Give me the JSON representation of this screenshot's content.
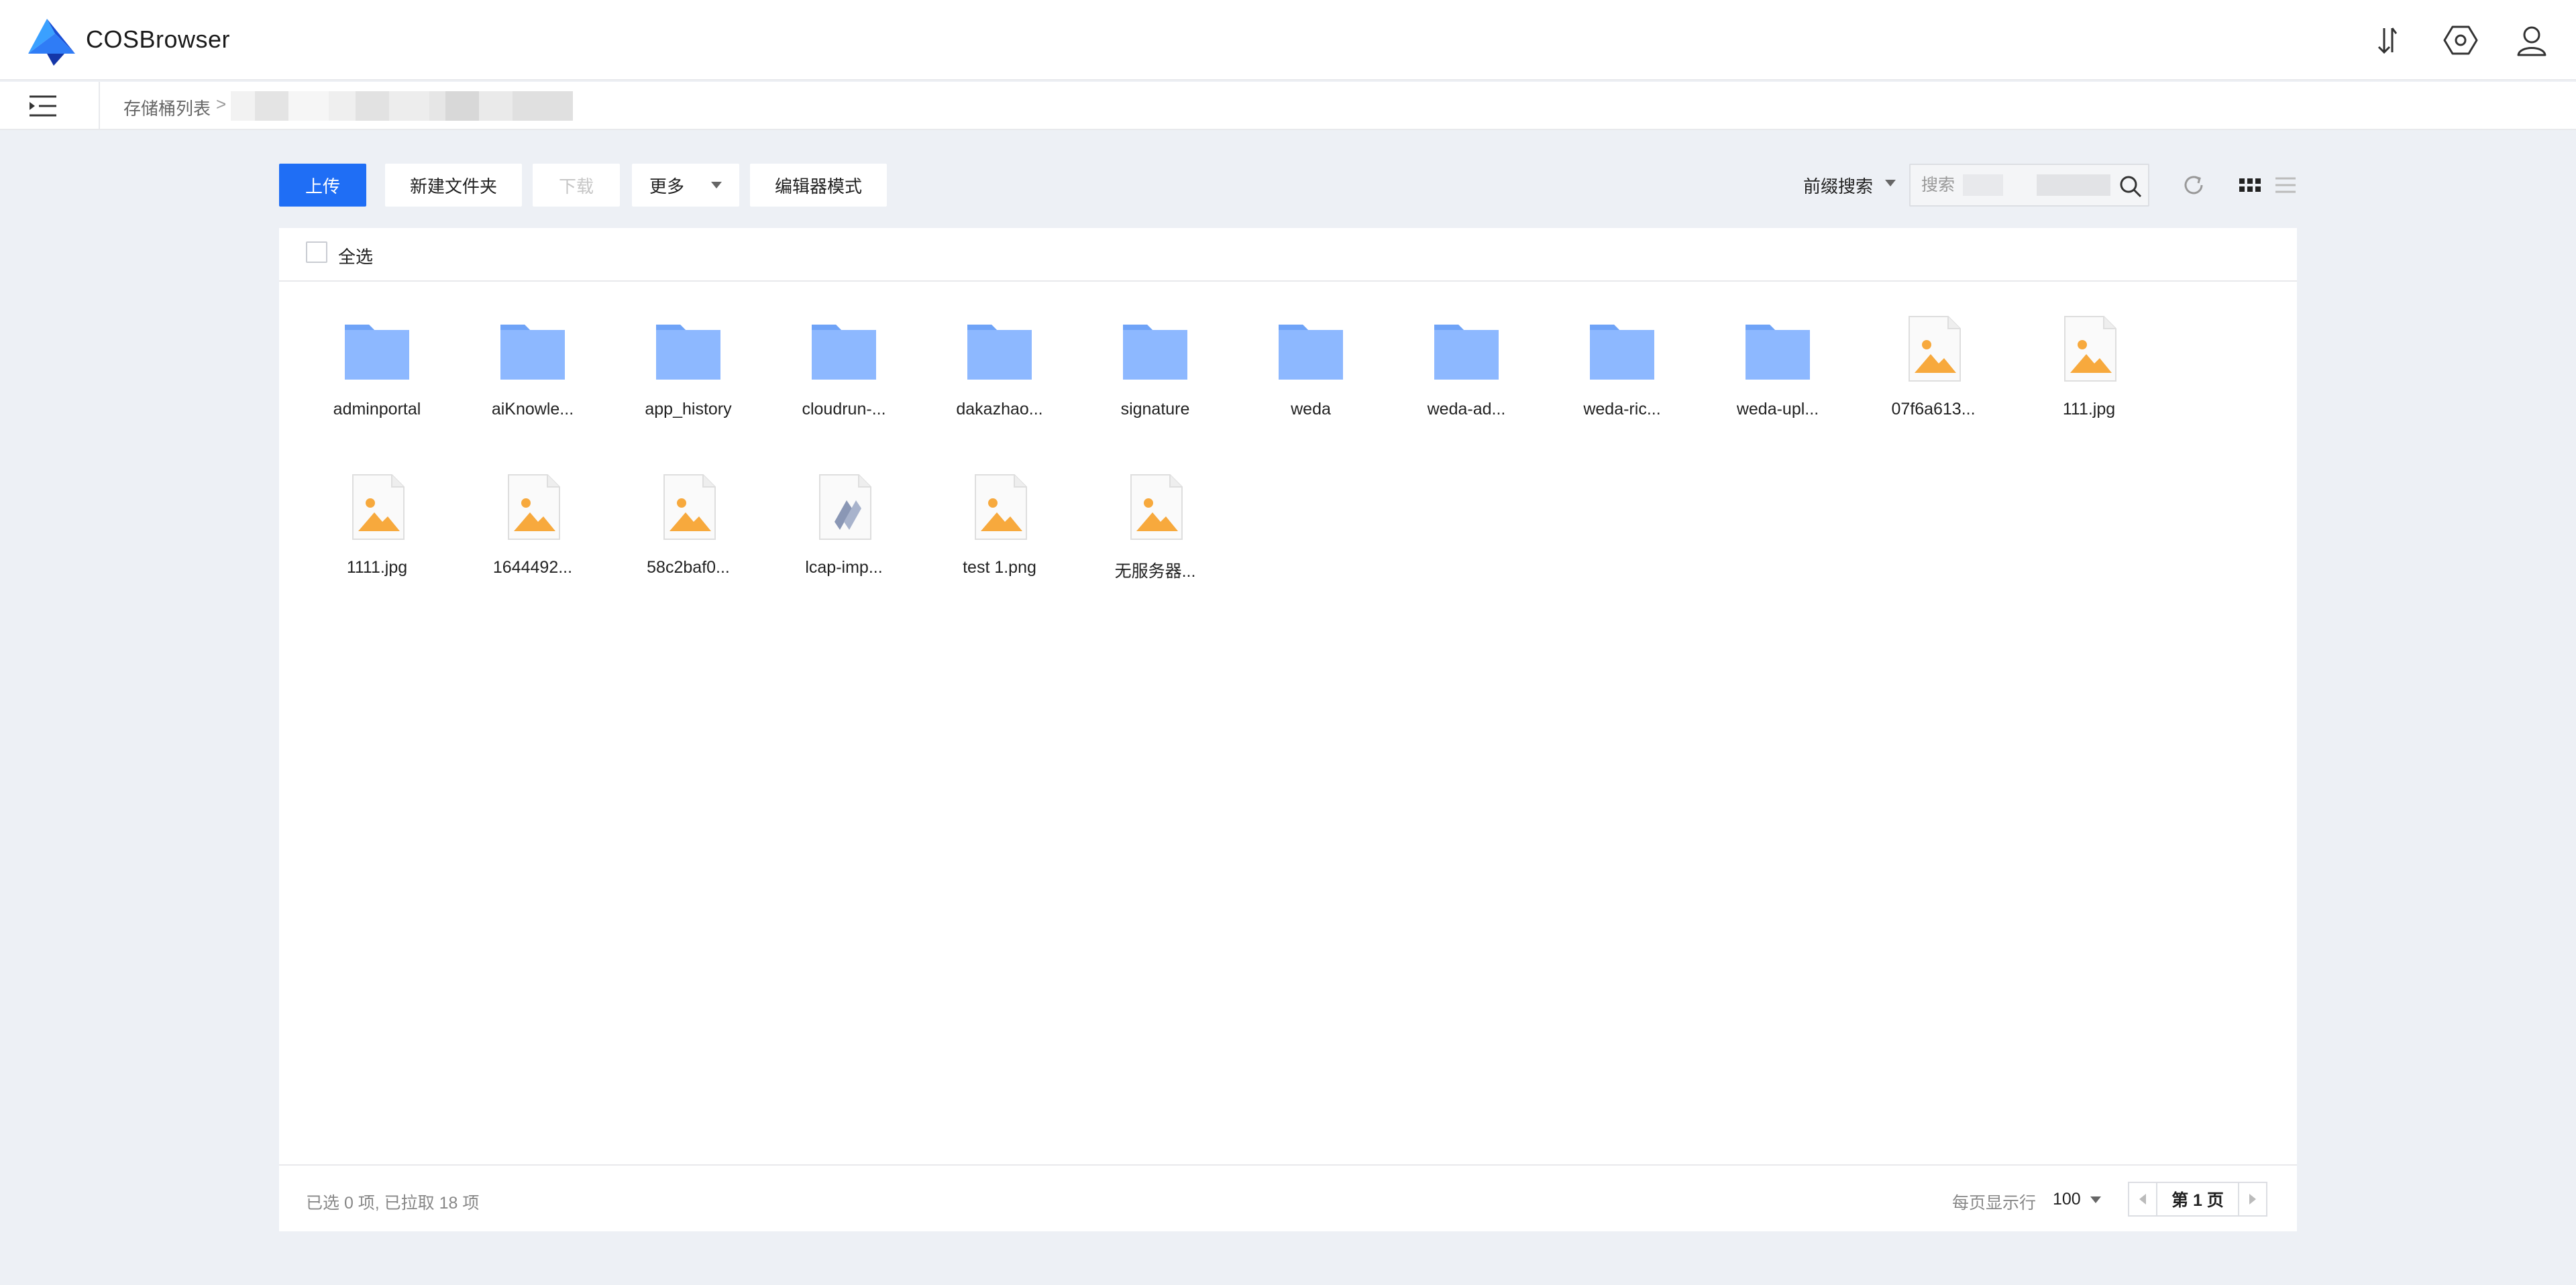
{
  "app": {
    "title": "COSBrowser",
    "colors": {
      "accent": "#1f6ef5",
      "folder": "#8db8ff",
      "image_icon": "#f7a93d",
      "background": "#edf0f5"
    }
  },
  "header": {
    "icons": [
      "transfer-icon",
      "settings-icon",
      "user-icon"
    ]
  },
  "breadcrumb": {
    "root": "存储桶列表",
    "separator": ">"
  },
  "toolbar": {
    "upload": "上传",
    "new_folder": "新建文件夹",
    "download": "下载",
    "more": "更多",
    "editor_mode": "编辑器模式",
    "search_mode": "前缀搜索",
    "search_placeholder": "搜索"
  },
  "file_list": {
    "select_all": "全选",
    "items": [
      {
        "name": "adminportal",
        "type": "folder"
      },
      {
        "name": "aiKnowle...",
        "type": "folder"
      },
      {
        "name": "app_history",
        "type": "folder"
      },
      {
        "name": "cloudrun-...",
        "type": "folder"
      },
      {
        "name": "dakazhao...",
        "type": "folder"
      },
      {
        "name": "signature",
        "type": "folder"
      },
      {
        "name": "weda",
        "type": "folder"
      },
      {
        "name": "weda-ad...",
        "type": "folder"
      },
      {
        "name": "weda-ric...",
        "type": "folder"
      },
      {
        "name": "weda-upl...",
        "type": "folder"
      },
      {
        "name": "07f6a613...",
        "type": "image"
      },
      {
        "name": "111.jpg",
        "type": "image"
      },
      {
        "name": "1111.jpg",
        "type": "image"
      },
      {
        "name": "1644492...",
        "type": "image"
      },
      {
        "name": "58c2baf0...",
        "type": "image"
      },
      {
        "name": "lcap-imp...",
        "type": "file"
      },
      {
        "name": "test 1.png",
        "type": "image"
      },
      {
        "name": "无服务器...",
        "type": "image"
      }
    ]
  },
  "footer": {
    "status": "已选 0 项, 已拉取 18 项",
    "per_page_label": "每页显示行",
    "per_page_value": "100",
    "page_label": "第 1 页"
  }
}
